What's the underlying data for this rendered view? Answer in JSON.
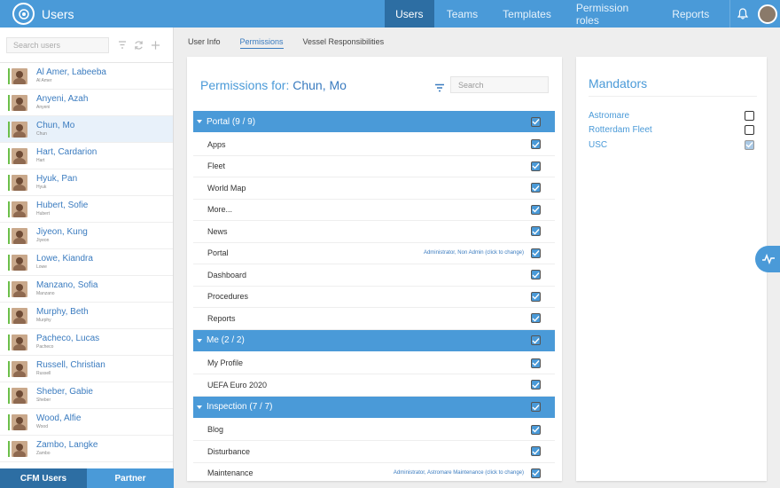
{
  "app": {
    "title": "Users"
  },
  "nav": [
    {
      "label": "Users",
      "active": true
    },
    {
      "label": "Teams"
    },
    {
      "label": "Templates"
    },
    {
      "label": "Permission roles"
    },
    {
      "label": "Reports"
    }
  ],
  "sidebar": {
    "search_placeholder": "Search users",
    "users": [
      {
        "name": "Al Amer, Labeeba",
        "sub": "Al Amer"
      },
      {
        "name": "Anyeni, Azah",
        "sub": "Anyeni"
      },
      {
        "name": "Chun, Mo",
        "sub": "Chun",
        "selected": true
      },
      {
        "name": "Hart, Cardarion",
        "sub": "Hart"
      },
      {
        "name": "Hyuk, Pan",
        "sub": "Hyuk"
      },
      {
        "name": "Hubert, Sofie",
        "sub": "Hubert"
      },
      {
        "name": "Jiyeon, Kung",
        "sub": "Jiyeon"
      },
      {
        "name": "Lowe, Kiandra",
        "sub": "Lowe"
      },
      {
        "name": "Manzano, Sofia",
        "sub": "Manzano"
      },
      {
        "name": "Murphy, Beth",
        "sub": "Murphy"
      },
      {
        "name": "Pacheco, Lucas",
        "sub": "Pacheco"
      },
      {
        "name": "Russell, Christian",
        "sub": "Russell"
      },
      {
        "name": "Sheber, Gabie",
        "sub": "Sheber"
      },
      {
        "name": "Wood, Alfie",
        "sub": "Wood"
      },
      {
        "name": "Zambo, Langke",
        "sub": "Zambo"
      }
    ],
    "tabs": {
      "cfm": "CFM Users",
      "partner": "Partner"
    }
  },
  "subtabs": {
    "user_info": "User Info",
    "permissions": "Permissions",
    "vessel": "Vessel Responsibilities"
  },
  "permissions": {
    "title_prefix": "Permissions for: ",
    "user_name": "Chun, Mo",
    "search_placeholder": "Search",
    "groups": [
      {
        "label": "Portal (9 / 9)",
        "items": [
          {
            "label": "Apps"
          },
          {
            "label": "Fleet"
          },
          {
            "label": "World Map"
          },
          {
            "label": "More..."
          },
          {
            "label": "News"
          },
          {
            "label": "Portal",
            "note": "Administrator, Non Admin (click to change)"
          },
          {
            "label": "Dashboard"
          },
          {
            "label": "Procedures"
          },
          {
            "label": "Reports"
          }
        ]
      },
      {
        "label": "Me (2 / 2)",
        "items": [
          {
            "label": "My Profile"
          },
          {
            "label": "UEFA Euro 2020"
          }
        ]
      },
      {
        "label": "Inspection (7 / 7)",
        "items": [
          {
            "label": "Blog"
          },
          {
            "label": "Disturbance"
          },
          {
            "label": "Maintenance",
            "note": "Administrator, Astromare Maintenance (click to change)"
          }
        ]
      }
    ]
  },
  "mandators": {
    "title": "Mandators",
    "items": [
      {
        "label": "Astromare",
        "state": "empty"
      },
      {
        "label": "Rotterdam Fleet",
        "state": "empty"
      },
      {
        "label": "USC",
        "state": "disabled"
      }
    ]
  },
  "colors": {
    "primary": "#4a9ad8",
    "dark": "#2d6ea3",
    "link": "#3a7bbf",
    "status": "#6cbf4a"
  }
}
